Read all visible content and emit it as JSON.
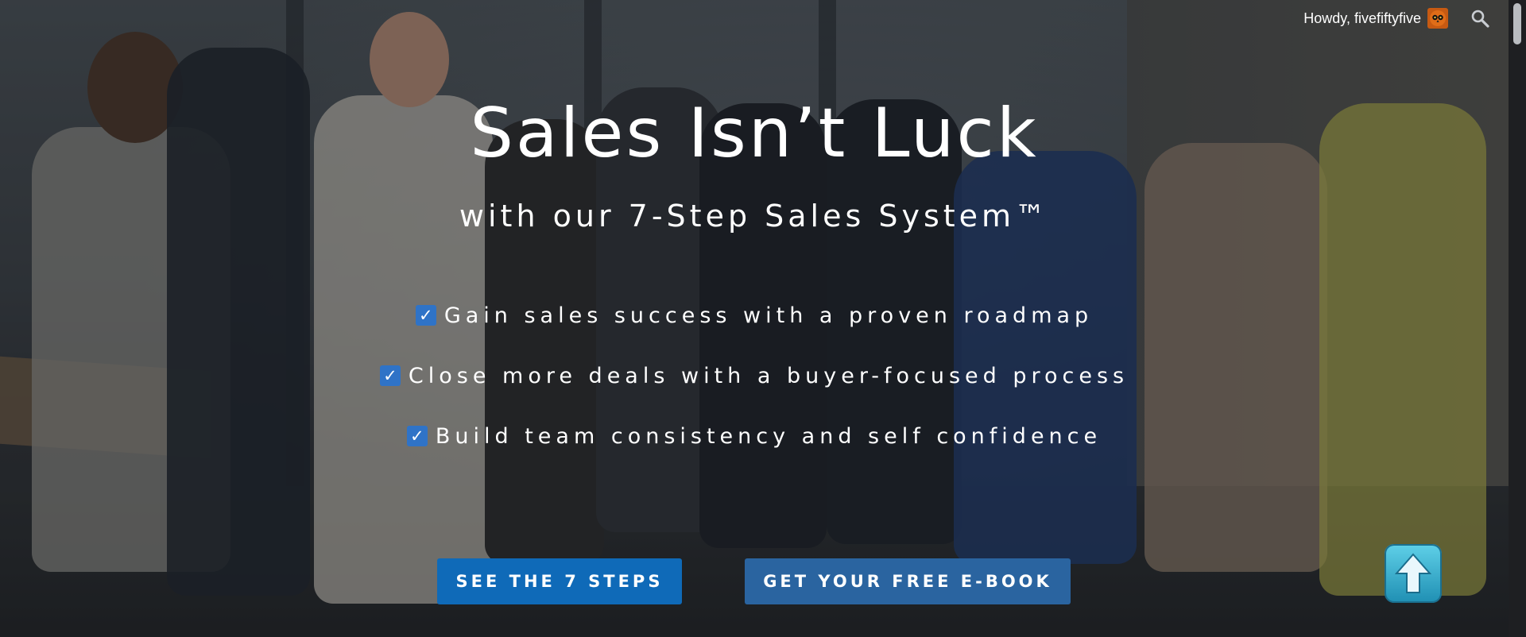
{
  "topbar": {
    "greeting": "Howdy, fivefiftyfive"
  },
  "hero": {
    "title": "Sales Isn’t Luck",
    "subtitle": "with our 7-Step Sales System™",
    "bullets": [
      "Gain sales success with a proven roadmap",
      "Close more deals with a buyer-focused process",
      "Build team consistency and self confidence"
    ],
    "check_glyph": "✓"
  },
  "buttons": {
    "steps_label": "SEE THE 7 STEPS",
    "ebook_label": "GET YOUR FREE E-BOOK"
  },
  "icons": {
    "avatar": "owl-avatar-icon",
    "search": "search-icon",
    "back_to_top": "arrow-up-icon"
  },
  "colors": {
    "primary_button": "#0f6ab8",
    "secondary_button": "#2a64a0",
    "checkbox": "#2f73c7",
    "back_to_top": "#3bb3d4"
  }
}
